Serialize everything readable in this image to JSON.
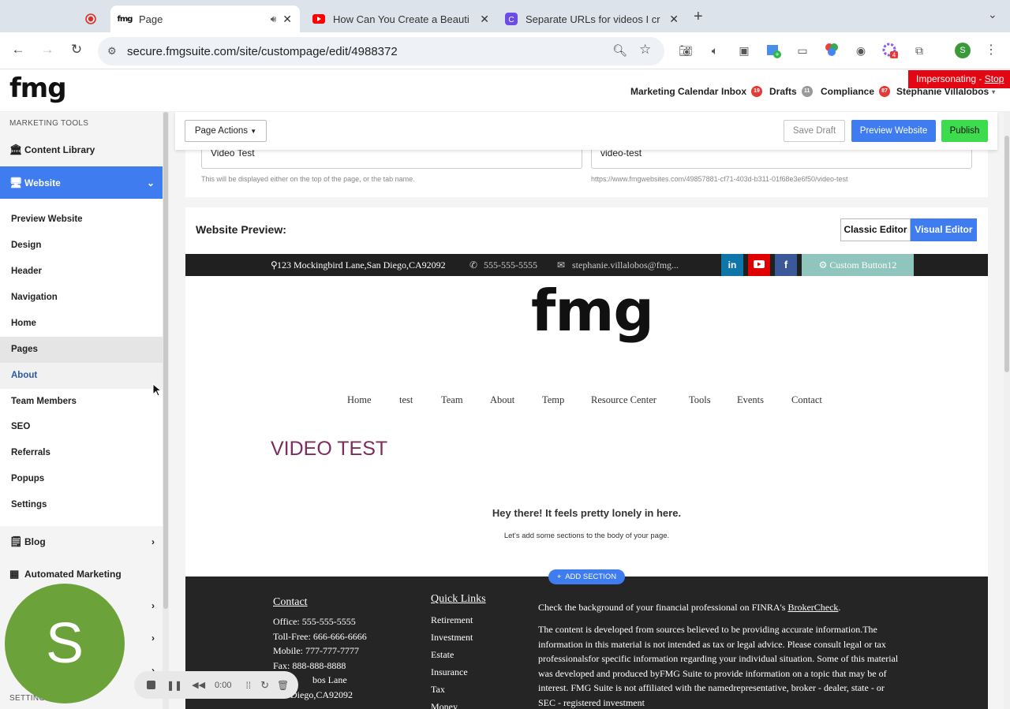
{
  "browser": {
    "tabs": [
      {
        "title": "",
        "icon": "record-icon"
      },
      {
        "title": "Page",
        "favicon": "fmg",
        "active": true
      },
      {
        "title": "How Can You Create a Beauti",
        "icon": "youtube-icon"
      },
      {
        "title": "Separate URLs for videos I cr",
        "icon": "app-c-icon"
      }
    ],
    "url": "secure.fmgsuite.com/site/custompage/edit/4988372",
    "profile_initial": "S",
    "ext_badge": "4"
  },
  "app": {
    "logo": "fmg",
    "nav": {
      "marketing_calendar": "Marketing Calendar",
      "inbox": "Inbox",
      "inbox_count": "19",
      "drafts": "Drafts",
      "drafts_count": "11",
      "compliance": "Compliance",
      "compliance_count": "87",
      "user": "Stephanie Villalobos"
    },
    "impersonating": "Impersonating - ",
    "stop": "Stop"
  },
  "sidebar": {
    "section": "MARKETING TOOLS",
    "content_library": "Content Library",
    "website": "Website",
    "subitems": [
      "Preview Website",
      "Design",
      "Header",
      "Navigation",
      "Home",
      "Pages",
      "About",
      "Team Members",
      "SEO",
      "Referrals",
      "Popups",
      "Settings"
    ],
    "blog": "Blog",
    "automated_marketing": "Automated Marketing",
    "settings_section": "SETTINGS"
  },
  "toolbar": {
    "page_actions": "Page Actions",
    "save_draft": "Save Draft",
    "preview_website": "Preview Website",
    "publish": "Publish"
  },
  "form": {
    "title_value": "Video Test",
    "title_hint": "This will be displayed either on the top of the page, or the tab name.",
    "slug_value": "video-test",
    "slug_hint": "https://www.fmgwebsites.com/49857881-cf71-403d-b311-01f68e3e6f50/video-test"
  },
  "preview": {
    "heading": "Website Preview:",
    "classic_editor": "Classic Editor",
    "visual_editor": "Visual Editor",
    "address": "123 Mockingbird Lane,San Diego,CA92092",
    "phone": "555-555-5555",
    "email": "stephanie.villalobos@fmg...",
    "custom_button": "Custom Button12",
    "site_logo": "fmg",
    "site_nav": [
      "Home",
      "test",
      "Team",
      "About",
      "Temp",
      "Resource Center",
      "Tools",
      "Events",
      "Contact"
    ],
    "page_title": "VIDEO TEST",
    "empty_title": "Hey there! It feels pretty lonely in here.",
    "empty_sub": "Let's add some sections to the body of your page.",
    "add_section": "ADD SECTION"
  },
  "footer": {
    "contact_title": "Contact",
    "contact_lines": [
      "Office: 555-555-5555",
      "Toll-Free: 666-666-6666",
      "Mobile: 777-777-7777",
      "Fax: 888-888-8888",
      "bos Lane",
      "Diego,CA92092"
    ],
    "quick_links_title": "Quick Links",
    "quick_links": [
      "Retirement",
      "Investment",
      "Estate",
      "Insurance",
      "Tax",
      "Money"
    ],
    "finra_text": "Check the background of your financial professional on FINRA's ",
    "brokercheck": "BrokerCheck",
    "disclaimer": "The content is developed from sources believed to be providing accurate information.The information in this material is not intended as tax or legal advice. Please consult legal or tax professionalsfor specific information regarding your individual situation. Some of this material was developed and produced byFMG Suite to provide information on a topic that may be of interest. FMG Suite is not affiliated with the namedrepresentative, broker - dealer, state - or SEC - registered investment"
  },
  "overlay": {
    "avatar_initial": "S",
    "timer": "0:00"
  }
}
